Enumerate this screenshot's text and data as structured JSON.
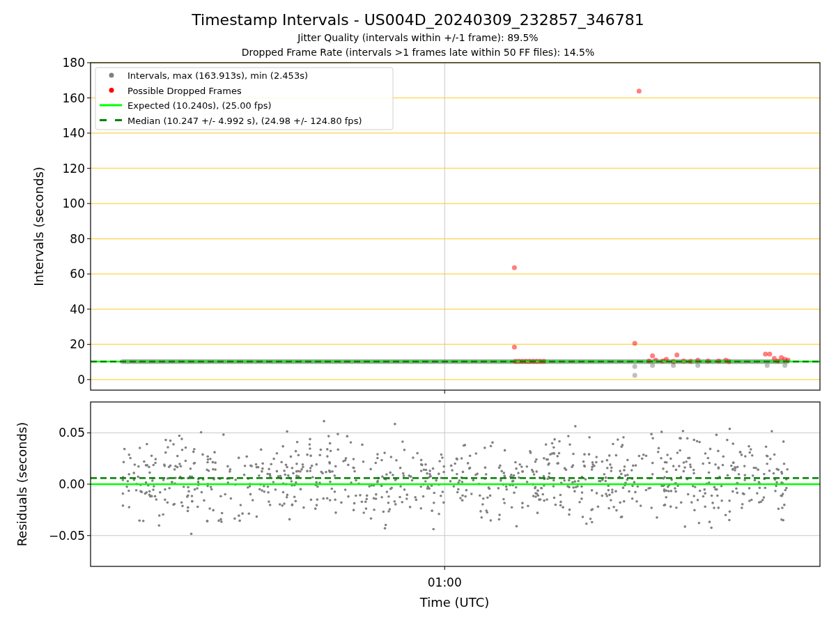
{
  "figure": {
    "title": "Timestamp Intervals - US004D_20240309_232857_346781",
    "subtitles": [
      "Jitter Quality (intervals within +/-1 frame): 89.5%",
      "Dropped Frame Rate (intervals >1 frames late within 50 FF files): 14.5%"
    ]
  },
  "intervals_plot": {
    "ylabel": "Intervals (seconds)",
    "yticks": [
      "180",
      "160",
      "140",
      "120",
      "100",
      "80",
      "60",
      "40",
      "20",
      "0"
    ],
    "legend": [
      {
        "label": "Intervals, max (163.913s), min (2.453s)",
        "kind": "points",
        "color": "#808080"
      },
      {
        "label": "Possible Dropped Frames",
        "kind": "points",
        "color": "#ff0000"
      },
      {
        "label": "Expected (10.240s), (25.00 fps)",
        "kind": "solid",
        "color": "#00ff00"
      },
      {
        "label": "Median (10.247 +/- 4.992 s), (24.98 +/- 124.80 fps)",
        "kind": "dashed",
        "color": "#008000"
      }
    ]
  },
  "residuals_plot": {
    "ylabel": "Residuals (seconds)",
    "yticks": [
      "0.05",
      "0.00",
      "−0.05"
    ],
    "xticks": [
      "01:00"
    ],
    "xlabel": "Time (UTC)"
  }
}
